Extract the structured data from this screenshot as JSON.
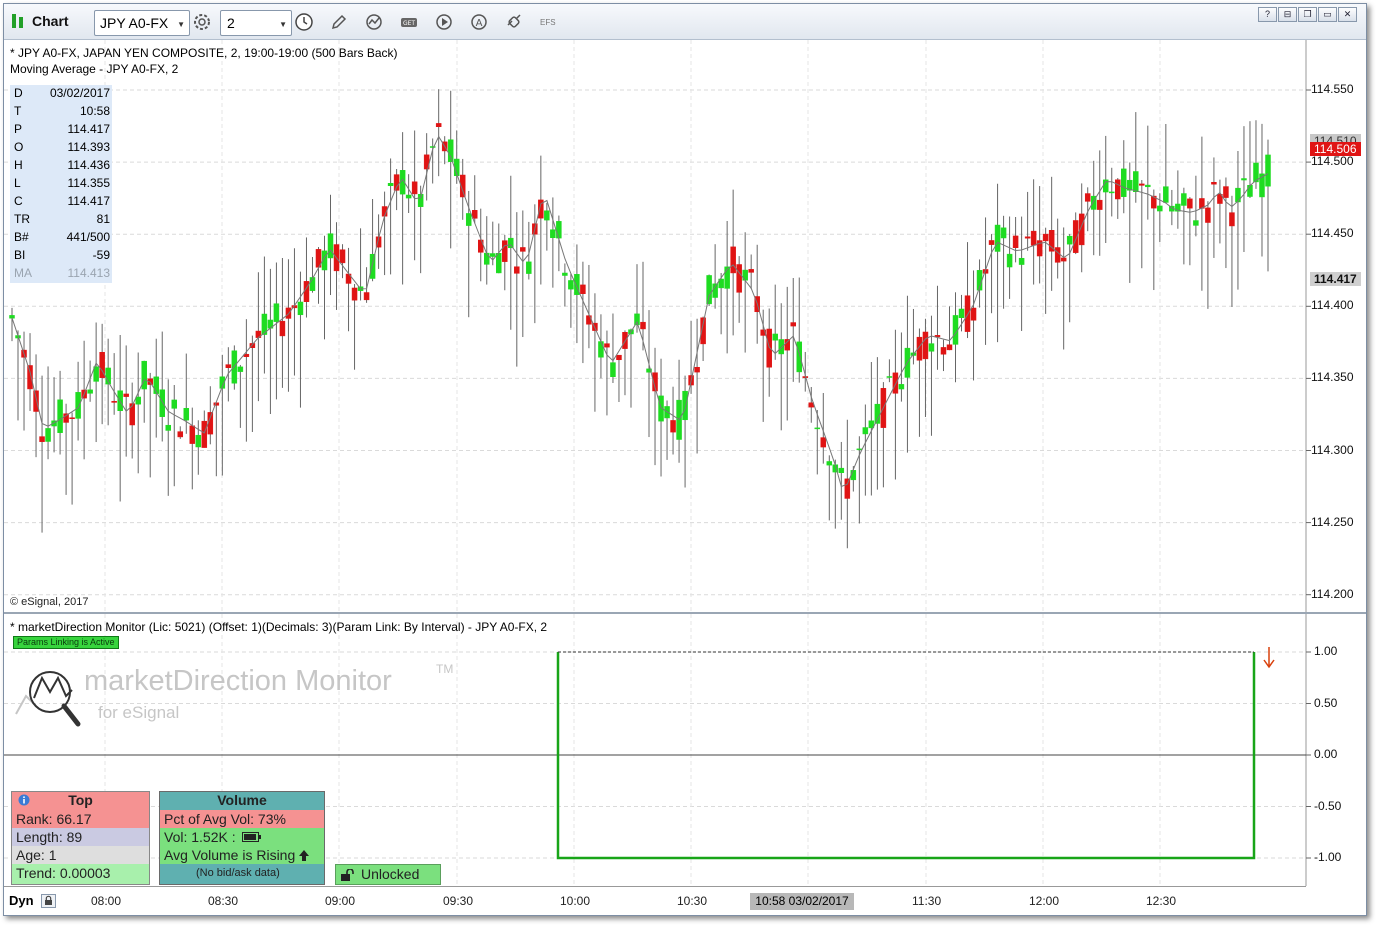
{
  "toolbar": {
    "title": "Chart",
    "symbol": "JPY A0-FX",
    "interval": "2",
    "efs_label": "EFS"
  },
  "window_buttons": [
    "?",
    "⊟",
    "❐",
    "▭",
    "✕"
  ],
  "main_chart": {
    "title_line": "* JPY A0-FX, JAPAN YEN COMPOSITE, 2, 19:00-19:00 (500 Bars Back)",
    "study_line": "Moving Average - JPY A0-FX, 2",
    "copyright": "© eSignal, 2017",
    "current_price": "114.506",
    "cursor_price": "114.417",
    "hidden_price": "114.510",
    "up_color": "#1edc21",
    "down_color": "#e01414",
    "y_ticks": [
      "114.550",
      "114.500",
      "114.450",
      "114.400",
      "114.350",
      "114.300",
      "114.250",
      "114.200"
    ],
    "data_window": [
      {
        "k": "D",
        "v": "03/02/2017"
      },
      {
        "k": "T",
        "v": "10:58"
      },
      {
        "k": "P",
        "v": "114.417"
      },
      {
        "k": "O",
        "v": "114.393"
      },
      {
        "k": "H",
        "v": "114.436"
      },
      {
        "k": "L",
        "v": "114.355"
      },
      {
        "k": "C",
        "v": "114.417"
      },
      {
        "k": "TR",
        "v": "81"
      },
      {
        "k": "B#",
        "v": "441/500"
      },
      {
        "k": "BI",
        "v": "-59"
      },
      {
        "k": "MA",
        "v": "114.413"
      }
    ]
  },
  "indicator": {
    "title_line": "* marketDirection Monitor (Lic: 5021) (Offset: 1)(Decimals: 3)(Param Link: By Interval) - JPY A0-FX, 2",
    "params_badge": "Params Linking is Active",
    "logo_main": "marketDirection Monitor",
    "logo_tm": "TM",
    "logo_sub": "for eSignal",
    "y_ticks": [
      "1.00",
      "0.50",
      "0.00",
      "-0.50",
      "-1.00"
    ],
    "top_panel": {
      "header": "Top",
      "rank": "Rank: 66.17",
      "length": "Length: 89",
      "age": "Age: 1",
      "trend": "Trend: 0.00003"
    },
    "volume_panel": {
      "header": "Volume",
      "pct": "Pct of Avg Vol: 73%",
      "vol": "Vol: 1.52K :",
      "rising": "Avg Volume is Rising",
      "bidask": "(No bid/ask data)"
    },
    "lock_label": "Unlocked"
  },
  "x_axis": {
    "mode": "Dyn",
    "labels": [
      "08:00",
      "08:30",
      "09:00",
      "09:30",
      "10:00",
      "10:30",
      "11:30",
      "12:00",
      "12:30"
    ],
    "cursor_label": "10:58 03/02/2017"
  }
}
